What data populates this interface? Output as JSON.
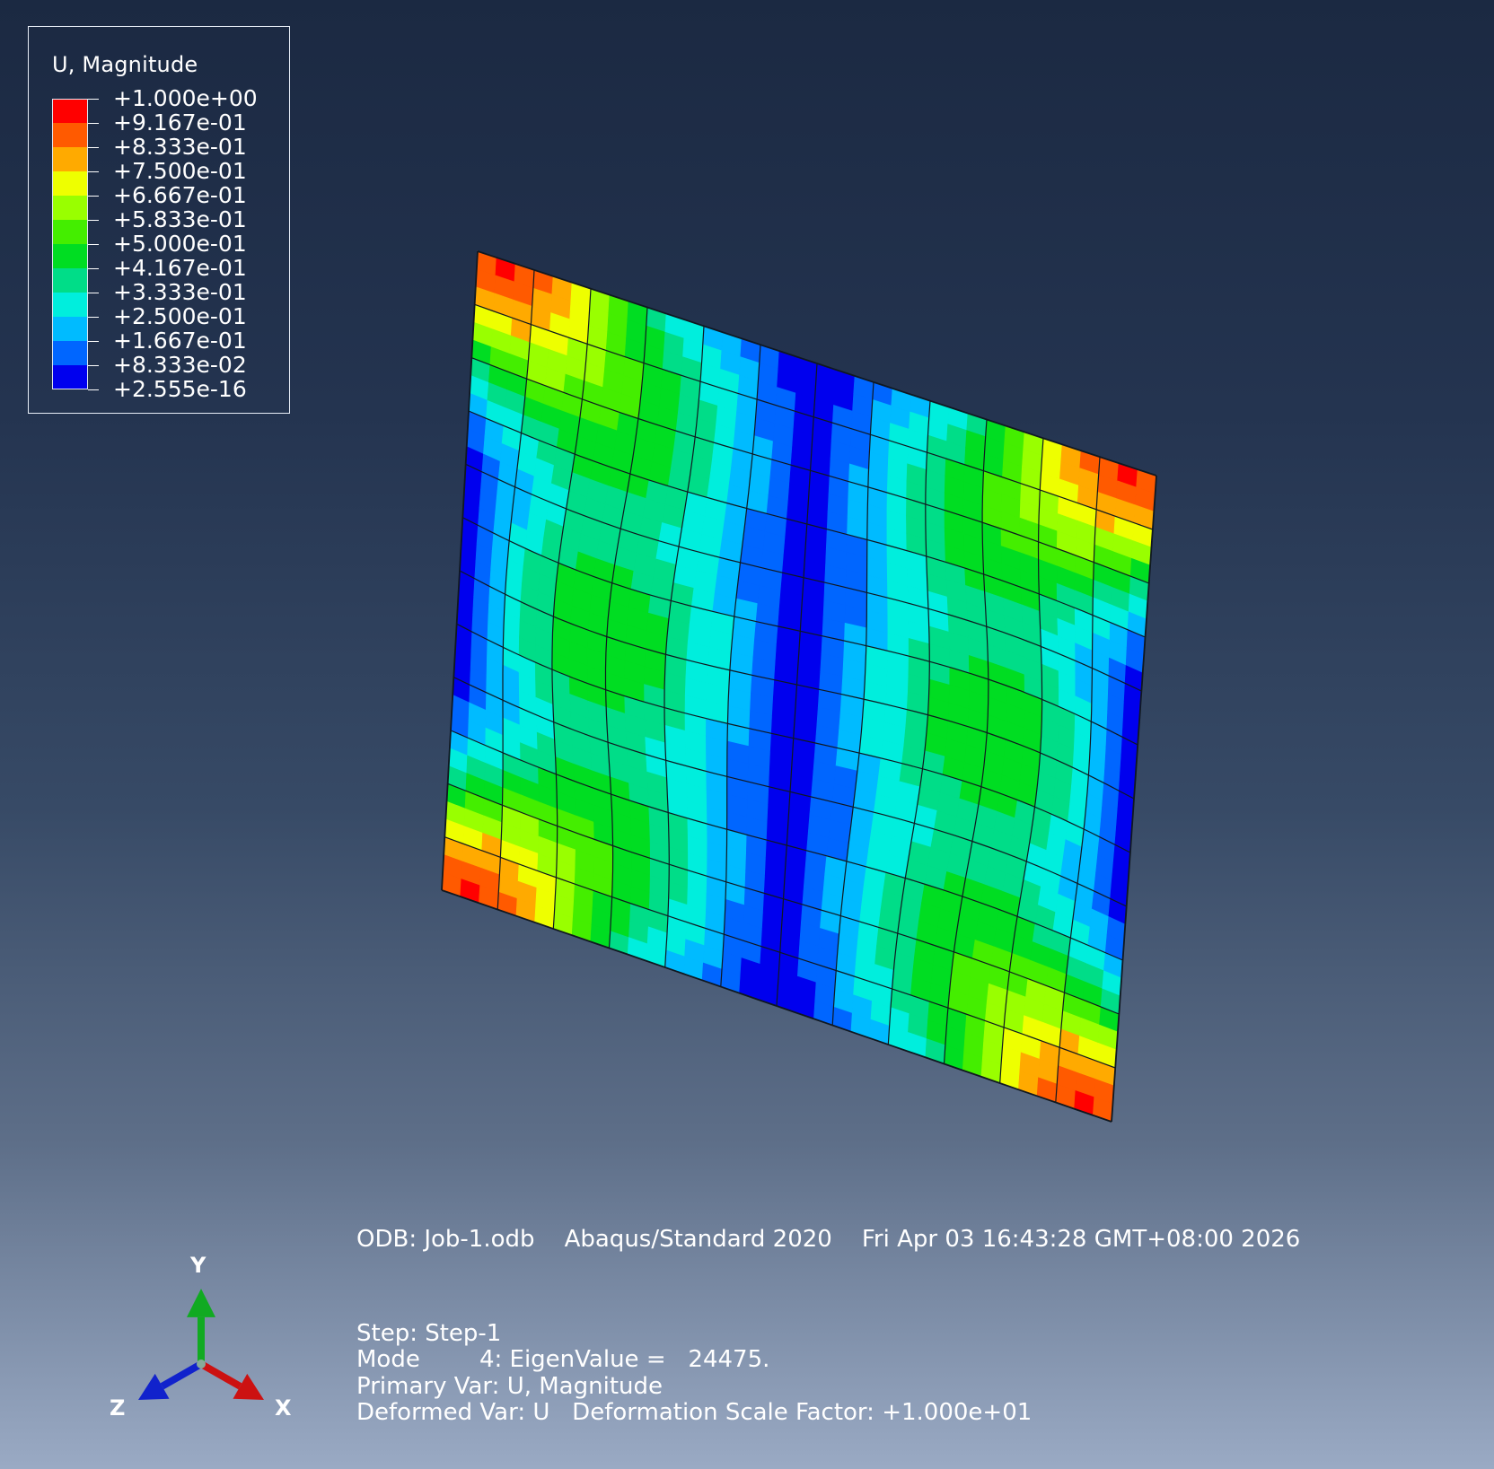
{
  "legend": {
    "title": "U, Magnitude",
    "levels": [
      {
        "label": "+1.000e+00",
        "color": "#ff0000"
      },
      {
        "label": "+9.167e-01",
        "color": "#ff5a00"
      },
      {
        "label": "+8.333e-01",
        "color": "#ffaa00"
      },
      {
        "label": "+7.500e-01",
        "color": "#eeff00"
      },
      {
        "label": "+6.667e-01",
        "color": "#99ff00"
      },
      {
        "label": "+5.833e-01",
        "color": "#44ee00"
      },
      {
        "label": "+5.000e-01",
        "color": "#00dd22"
      },
      {
        "label": "+4.167e-01",
        "color": "#00dd88"
      },
      {
        "label": "+3.333e-01",
        "color": "#00eedd"
      },
      {
        "label": "+2.500e-01",
        "color": "#00bbff"
      },
      {
        "label": "+1.667e-01",
        "color": "#0066ff"
      },
      {
        "label": "+8.333e-02",
        "color": "#0000ee"
      },
      {
        "label": "+2.555e-16",
        "color": ""
      }
    ]
  },
  "info": {
    "odb_line": "ODB: Job-1.odb    Abaqus/Standard 2020    Fri Apr 03 16:43:28 GMT+08:00 2026",
    "step_line": "Step: Step-1",
    "mode_line": "Mode        4: EigenValue =   24475.",
    "primary_line": "Primary Var: U, Magnitude",
    "deformed_line": "Deformed Var: U   Deformation Scale Factor: +1.000e+01"
  },
  "triad": {
    "x_label": "X",
    "y_label": "Y",
    "z_label": "Z",
    "x_color": "#cc1111",
    "y_color": "#11aa22",
    "z_color": "#1122cc"
  },
  "mesh": {
    "grid_rows": 12,
    "grid_cols": 12,
    "line_color": "#101820"
  }
}
